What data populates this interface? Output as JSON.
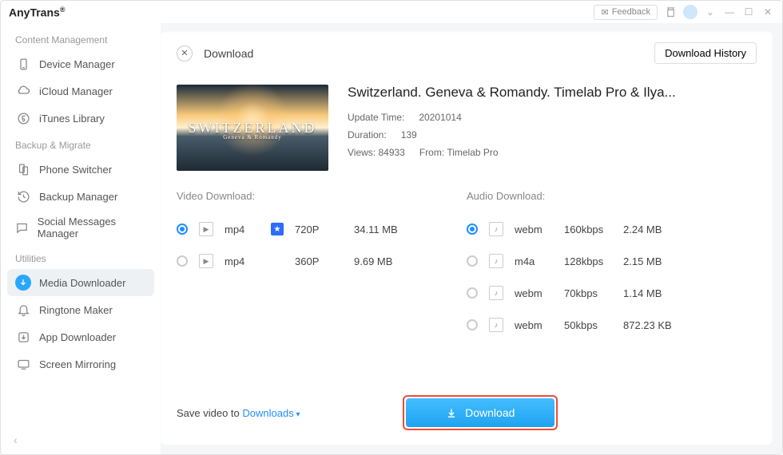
{
  "app": {
    "name": "AnyTrans",
    "reg": "®"
  },
  "titlebar": {
    "feedback": "Feedback"
  },
  "sidebar": {
    "sections": {
      "content": "Content Management",
      "backup": "Backup & Migrate",
      "utilities": "Utilities"
    },
    "items": {
      "device": "Device Manager",
      "icloud": "iCloud Manager",
      "itunes": "iTunes Library",
      "phone": "Phone Switcher",
      "backup": "Backup Manager",
      "social": "Social Messages Manager",
      "media": "Media Downloader",
      "ringtone": "Ringtone Maker",
      "appdl": "App Downloader",
      "mirror": "Screen Mirroring"
    }
  },
  "page": {
    "title": "Download",
    "history": "Download History"
  },
  "video": {
    "thumb_text": "SWITZERLAND",
    "thumb_sub": "Geneva & Romandy",
    "title": "Switzerland. Geneva & Romandy. Timelab Pro & Ilya...",
    "update_label": "Update Time:",
    "update_value": "20201014",
    "duration_label": "Duration:",
    "duration_value": "139",
    "views_label": "Views:",
    "views_value": "84933",
    "from_label": "From:",
    "from_value": "Timelab Pro"
  },
  "downloads": {
    "video_label": "Video Download:",
    "audio_label": "Audio Download:",
    "video": [
      {
        "format": "mp4",
        "quality": "720P",
        "size": "34.11 MB",
        "selected": true,
        "badge": true
      },
      {
        "format": "mp4",
        "quality": "360P",
        "size": "9.69 MB",
        "selected": false,
        "badge": false
      }
    ],
    "audio": [
      {
        "format": "webm",
        "bitrate": "160kbps",
        "size": "2.24 MB",
        "selected": true
      },
      {
        "format": "m4a",
        "bitrate": "128kbps",
        "size": "2.15 MB",
        "selected": false
      },
      {
        "format": "webm",
        "bitrate": "70kbps",
        "size": "1.14 MB",
        "selected": false
      },
      {
        "format": "webm",
        "bitrate": "50kbps",
        "size": "872.23 KB",
        "selected": false
      }
    ]
  },
  "footer": {
    "save_label": "Save video to",
    "save_dest": "Downloads",
    "download_btn": "Download"
  }
}
